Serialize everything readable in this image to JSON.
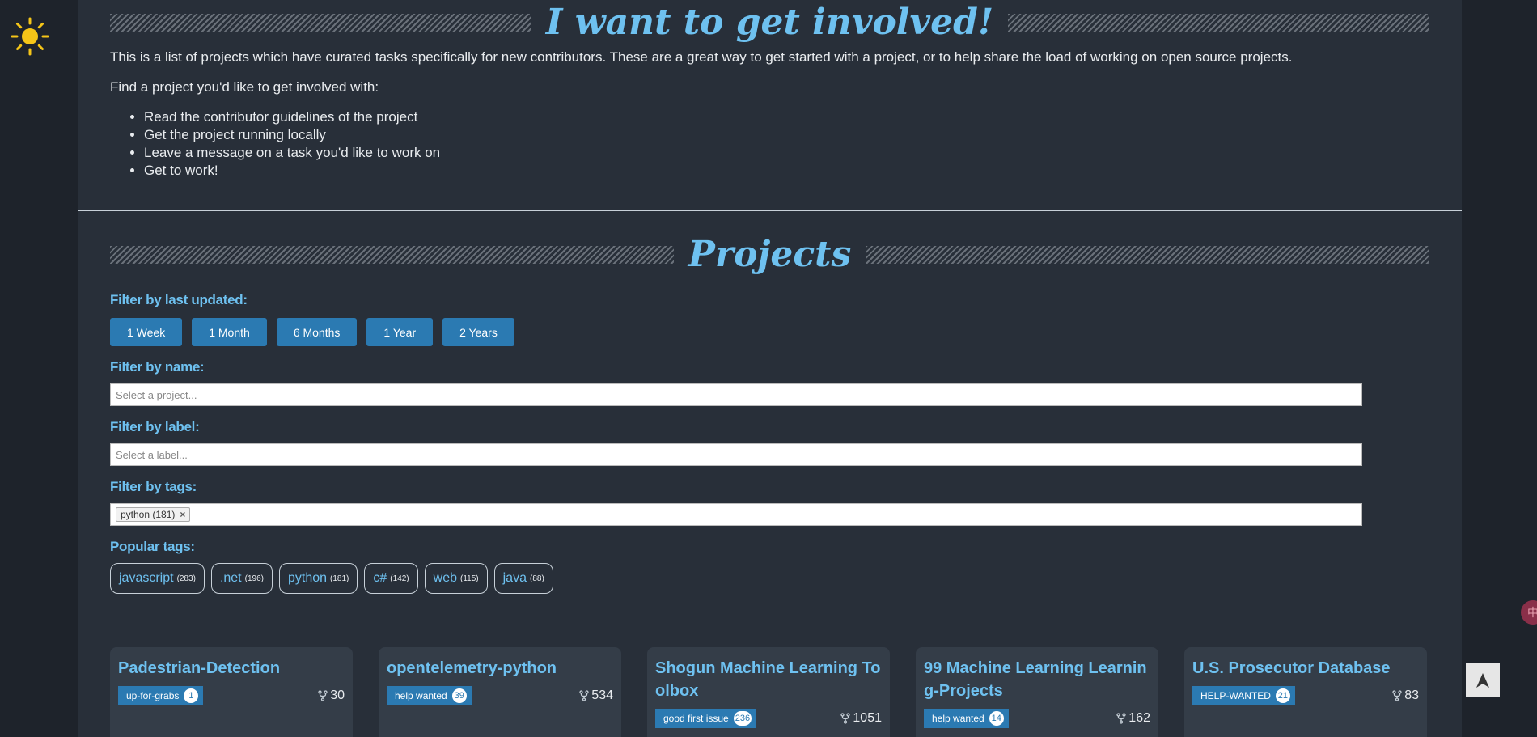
{
  "intro": {
    "title": "I want to get involved!",
    "description": "This is a list of projects which have curated tasks specifically for new contributors. These are a great way to get started with a project, or to help share the load of working on open source projects.",
    "steps_intro": "Find a project you'd like to get involved with:",
    "steps": [
      "Read the contributor guidelines of the project",
      "Get the project running locally",
      "Leave a message on a task you'd like to work on",
      "Get to work!"
    ]
  },
  "projects": {
    "title": "Projects",
    "filter_updated_label": "Filter by last updated:",
    "filter_updated_options": [
      "1 Week",
      "1 Month",
      "6 Months",
      "1 Year",
      "2 Years"
    ],
    "filter_name_label": "Filter by name:",
    "filter_name_placeholder": "Select a project...",
    "filter_label_label": "Filter by label:",
    "filter_label_placeholder": "Select a label...",
    "filter_tags_label": "Filter by tags:",
    "selected_tag": "python (181)",
    "popular_tags_label": "Popular tags:",
    "popular_tags": [
      {
        "name": "javascript",
        "count": "(283)"
      },
      {
        "name": ".net",
        "count": "(196)"
      },
      {
        "name": "python",
        "count": "(181)"
      },
      {
        "name": "c#",
        "count": "(142)"
      },
      {
        "name": "web",
        "count": "(115)"
      },
      {
        "name": "java",
        "count": "(88)"
      }
    ],
    "cards": [
      {
        "title": "Padestrian-Detection",
        "label": "up-for-grabs",
        "label_count": "1",
        "forks": "30"
      },
      {
        "title": "opentelemetry-python",
        "label": "help wanted",
        "label_count": "39",
        "forks": "534"
      },
      {
        "title": "Shogun Machine Learning Toolbox",
        "label": "good first issue",
        "label_count": "236",
        "forks": "1051"
      },
      {
        "title": "99 Machine Learning Learning-Projects",
        "label": "help wanted",
        "label_count": "14",
        "forks": "162"
      },
      {
        "title": "U.S. Prosecutor Database",
        "label": "HELP-WANTED",
        "label_count": "21",
        "forks": "83"
      }
    ]
  },
  "side_bubble": "中",
  "colors": {
    "accent": "#6ec1f0",
    "button": "#2b7ab2",
    "panel": "#282f39",
    "background": "#1e232b",
    "card": "#343d48",
    "sun": "#f5c518"
  },
  "icons": {
    "theme_toggle": "sun-icon",
    "scroll_top": "arrow-up-icon",
    "forks": "fork-icon"
  }
}
